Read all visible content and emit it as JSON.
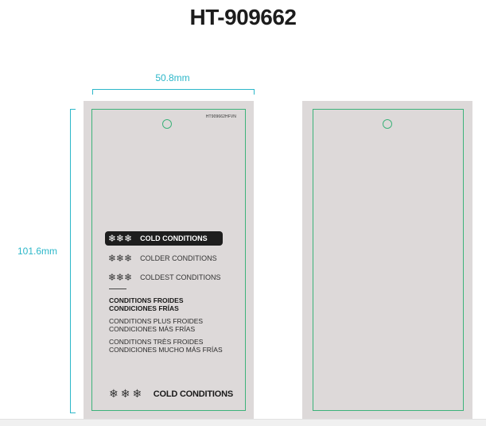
{
  "title": "HT-909662",
  "dimensions": {
    "width_label": "50.8mm",
    "height_label": "101.6mm"
  },
  "front": {
    "code": "HT909662HFVN",
    "conditions": [
      {
        "flakes": "❄❄❄",
        "label": "COLD CONDITIONS",
        "active": true
      },
      {
        "flakes": "❄❄❄",
        "label": "COLDER CONDITIONS",
        "active": false
      },
      {
        "flakes": "❄❄❄",
        "label": "COLDEST CONDITIONS",
        "active": false
      }
    ],
    "translations": [
      {
        "line1": "CONDITIONS FROIDES",
        "line2": "CONDICIONES FRÍAS",
        "bold": true
      },
      {
        "line1": "CONDITIONS PLUS FROIDES",
        "line2": "CONDICIONES MÁS FRÍAS",
        "bold": false
      },
      {
        "line1": "CONDITIONS TRÈS FROIDES",
        "line2": "CONDICIONES MUCHO MÁS FRÍAS",
        "bold": false
      }
    ],
    "bottom": {
      "flakes": "❄❄❄",
      "label": "COLD CONDITIONS"
    }
  },
  "colors": {
    "accent": "#2cb7c9",
    "cut_line": "#3db27a",
    "tag_bg": "#ddd9d9"
  },
  "icons": {
    "snowflake": "snowflake-icon"
  }
}
